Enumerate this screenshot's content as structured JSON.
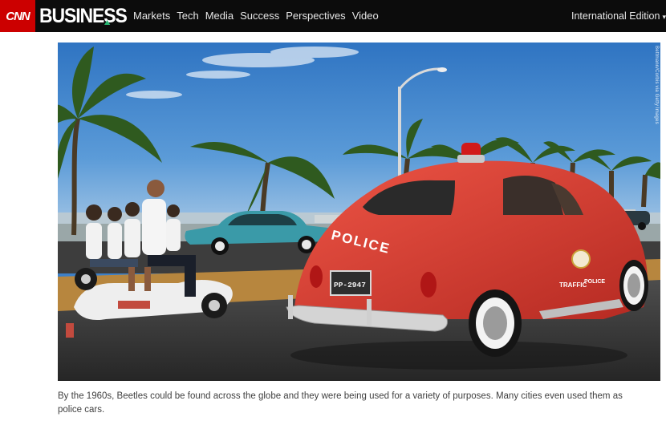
{
  "header": {
    "logo_text": "CNN",
    "section_logo_text": "BUSINESS",
    "nav_items": [
      "Markets",
      "Tech",
      "Media",
      "Success",
      "Perspectives",
      "Video"
    ],
    "edition_label": "International Edition",
    "edition_icon": "chevron-down-icon"
  },
  "photo": {
    "credit_text": "Bettmann/Corbis via Getty Images",
    "vehicle_lettering": "POLICE",
    "door_lettering_1": "TRAFFIC",
    "door_lettering_2": "POLICE",
    "plate_text": "PP-2947"
  },
  "caption": {
    "text": "By the 1960s, Beetles could be found across the globe and they were being used for a variety of purposes. Many cities even used them as police cars."
  },
  "colors": {
    "topbar": "#0c0c0c",
    "cnn_red": "#cc0000",
    "beetle_red": "#d93a2f",
    "sky": "#3f86cf",
    "caption_text": "#404040"
  }
}
